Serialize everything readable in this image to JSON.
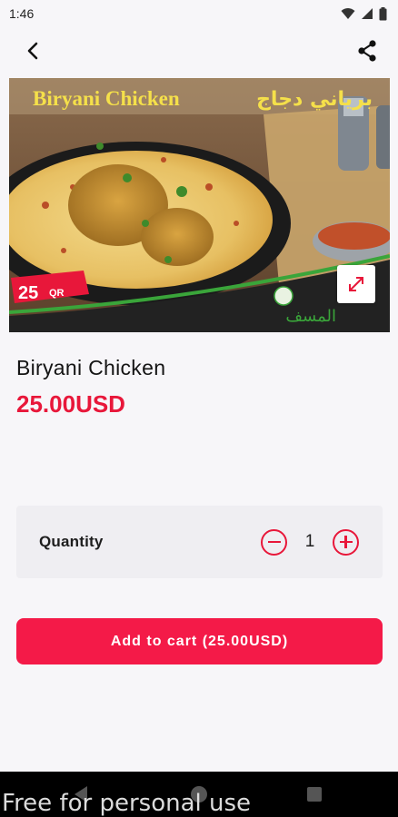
{
  "status_bar": {
    "time": "1:46"
  },
  "hero": {
    "title_en": "Biryani Chicken",
    "title_ar": "برياني دجاج",
    "price_tag": "25",
    "currency_tag": "QR",
    "brand_ar": "المسف"
  },
  "product": {
    "name": "Biryani Chicken",
    "price": "25.00USD"
  },
  "quantity": {
    "label": "Quantity",
    "value": "1"
  },
  "cart": {
    "button_label": "Add to cart (25.00USD)"
  },
  "watermark": "Free for personal use",
  "icons": {
    "back": "back-arrow-icon",
    "share": "share-icon",
    "expand": "expand-icon",
    "minus": "minus-icon",
    "plus": "plus-icon"
  },
  "colors": {
    "accent": "#e8173a",
    "button": "#f41a48",
    "background": "#f7f6f9",
    "card": "#efeef2"
  }
}
